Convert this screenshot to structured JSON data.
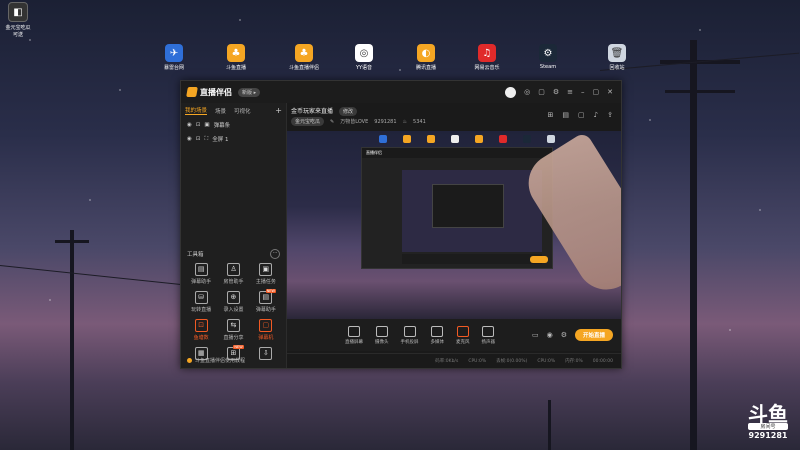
{
  "desktop": {
    "topleft_icon": {
      "label": "金元宝吃瓜\n可送"
    },
    "icons": [
      {
        "label": "暴雷台网",
        "icon": "blue-app-icon",
        "color": "#2f6fd8"
      },
      {
        "label": "斗鱼直播",
        "icon": "douyu-icon",
        "color": "#f5a623"
      },
      {
        "label": "斗鱼直播伴侣",
        "icon": "douyu-companion-icon",
        "color": "#f5a623"
      },
      {
        "label": "YY语音",
        "icon": "yy-icon",
        "color": "#fff"
      },
      {
        "label": "腾讯直播",
        "icon": "tencent-live-icon",
        "color": "#f5a623"
      },
      {
        "label": "网易云音乐",
        "icon": "netease-music-icon",
        "color": "#e02a2a"
      },
      {
        "label": "Steam",
        "icon": "steam-icon",
        "color": "#1b2838"
      },
      {
        "label": "回收站",
        "icon": "recycle-bin-icon",
        "color": "#cfd6e0"
      }
    ]
  },
  "app": {
    "title": "直播伴侣",
    "version": "新版 ▸",
    "sidebar": {
      "tabs": [
        "我的场景",
        "场景",
        "可视化"
      ],
      "scenes": [
        "弹幕条",
        "全屏 1"
      ],
      "tools_title": "工具箱",
      "tools": [
        {
          "label": "弹幕助手",
          "icon": "danmaku-icon",
          "red": false
        },
        {
          "label": "房管助手",
          "icon": "admin-icon",
          "red": false
        },
        {
          "label": "主播任务",
          "icon": "task-icon",
          "red": false
        },
        {
          "label": "玩转直播",
          "icon": "play-icon",
          "red": false
        },
        {
          "label": "录入设置",
          "icon": "record-icon",
          "red": false
        },
        {
          "label": "弹幕助手",
          "icon": "chat-icon",
          "red": false,
          "badge": "NEW"
        },
        {
          "label": "鱼塘数",
          "icon": "pond-icon",
          "red": true
        },
        {
          "label": "直播分享",
          "icon": "share-icon",
          "red": false
        },
        {
          "label": "弹幕机",
          "icon": "bullet-icon",
          "red": true
        },
        {
          "label": "",
          "icon": "calendar-icon",
          "red": false
        },
        {
          "label": "",
          "icon": "gift-icon",
          "red": false,
          "badge": "NEW"
        },
        {
          "label": "",
          "icon": "download-icon",
          "red": false
        }
      ],
      "footer": "斗鱼直播伴侣使用教程"
    },
    "room": {
      "title": "金币玩家来直播",
      "tag": "修改",
      "category": "金元宝吃瓜",
      "nickname": "万物皆LOVE",
      "room_id": "9291281",
      "viewers": "5341"
    },
    "controls": [
      {
        "label": "直播屏幕",
        "icon": "screen-icon"
      },
      {
        "label": "摄像头",
        "icon": "camera-icon"
      },
      {
        "label": "手机投屏",
        "icon": "phone-icon"
      },
      {
        "label": "多媒体",
        "icon": "media-icon"
      },
      {
        "label": "麦克风",
        "icon": "mic-icon",
        "red": true
      },
      {
        "label": "扬声器",
        "icon": "speaker-icon"
      }
    ],
    "go_live": "开始直播",
    "status": [
      "码率:0Kb/s",
      "CPU:0%",
      "丢帧:0(0.00%)",
      "CPU:0%",
      "内存:0%",
      "00:00:00"
    ]
  },
  "watermark": {
    "logo": "斗鱼",
    "room_label": "房间号",
    "room_id": "9291281"
  }
}
